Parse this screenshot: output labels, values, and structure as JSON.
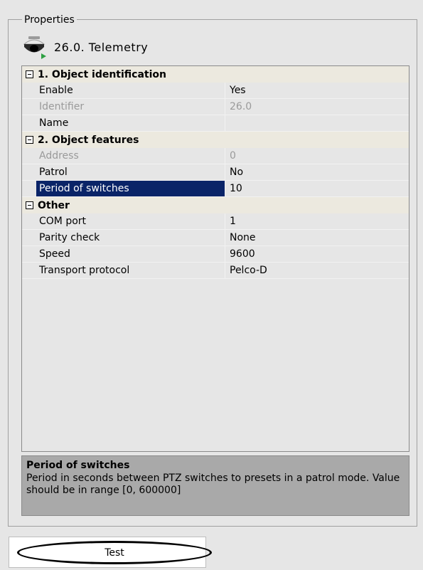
{
  "properties_label": "Properties",
  "object": {
    "title": "26.0. Telemetry",
    "icon": "ptz-camera-icon"
  },
  "grid": {
    "categories": [
      {
        "label": "1. Object identification",
        "rows": [
          {
            "name": "Enable",
            "value": "Yes",
            "disabled": false
          },
          {
            "name": "Identifier",
            "value": "26.0",
            "disabled": true
          },
          {
            "name": "Name",
            "value": "",
            "disabled": false
          }
        ]
      },
      {
        "label": "2. Object features",
        "rows": [
          {
            "name": "Address",
            "value": "0",
            "disabled": true
          },
          {
            "name": "Patrol",
            "value": "No",
            "disabled": false
          },
          {
            "name": "Period of switches",
            "value": "10",
            "disabled": false,
            "selected": true
          }
        ]
      },
      {
        "label": "Other",
        "rows": [
          {
            "name": "COM port",
            "value": "1",
            "disabled": false
          },
          {
            "name": "Parity check",
            "value": "None",
            "disabled": false
          },
          {
            "name": "Speed",
            "value": "9600",
            "disabled": false
          },
          {
            "name": "Transport protocol",
            "value": "Pelco-D",
            "disabled": false
          }
        ]
      }
    ]
  },
  "description": {
    "title": "Period of switches",
    "text": "Period in seconds between PTZ  switches to presets in a patrol mode. Value should be in range [0, 600000]"
  },
  "test_button_label": "Test",
  "colors": {
    "selection": "#0a2468",
    "category_bg": "#ece9df",
    "panel_bg": "#e6e6e6",
    "description_bg": "#a9a9a9"
  }
}
